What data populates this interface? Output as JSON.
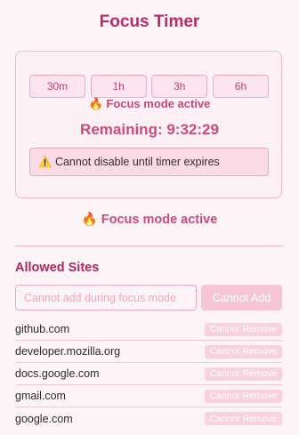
{
  "header": {
    "title": "Focus Timer"
  },
  "timer_card": {
    "presets": [
      "30m",
      "1h",
      "3h",
      "6h"
    ],
    "status": "🔥 Focus mode active",
    "remaining": "Remaining: 9:32:29",
    "warning_icon": "⚠️",
    "warning": "Cannot disable until timer expires"
  },
  "status_text": "🔥 Focus mode active",
  "allowed_sites": {
    "title": "Allowed Sites",
    "input_placeholder": "Cannot add during focus mode",
    "add_button": "Cannot Add",
    "remove_label": "Cannot Remove",
    "sites": [
      "github.com",
      "developer.mozilla.org",
      "docs.google.com",
      "gmail.com",
      "google.com"
    ]
  },
  "colors": {
    "accent": "#be2a64",
    "pink_light": "#fce5ee",
    "background": "#fdf4f7"
  }
}
